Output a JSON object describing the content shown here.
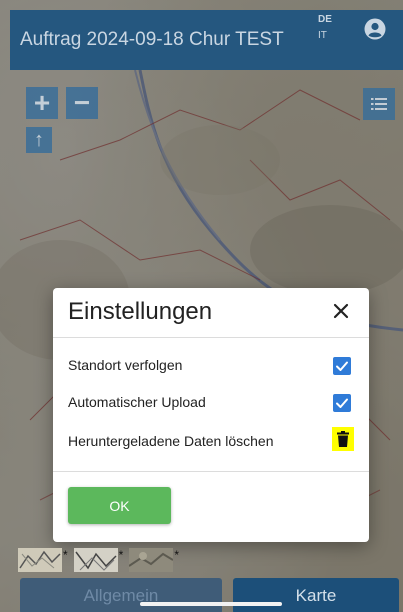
{
  "header": {
    "title": "Auftrag 2024-09-18 Chur TEST",
    "languages": [
      "DE",
      "IT"
    ],
    "user_icon": "user-circle-icon"
  },
  "map_controls": {
    "zoom_in": "+",
    "zoom_out": "−",
    "north": "↑",
    "layers_icon": "list-icon"
  },
  "dialog": {
    "title": "Einstellungen",
    "close_icon": "close-icon",
    "settings": [
      {
        "label": "Standort verfolgen",
        "checked": true
      },
      {
        "label": "Automatischer Upload",
        "checked": true
      },
      {
        "label": "Heruntergeladene Daten löschen",
        "icon": "trash-icon"
      }
    ],
    "ok_label": "OK"
  },
  "thumbnails": [
    {
      "name": "map-layer-1",
      "marker": "*"
    },
    {
      "name": "map-layer-2",
      "marker": "*"
    },
    {
      "name": "map-layer-3",
      "marker": "*"
    }
  ],
  "tabs": [
    {
      "label": "Allgemein",
      "active": false
    },
    {
      "label": "Karte",
      "active": true
    }
  ],
  "colors": {
    "header": "#25577f",
    "accent_checkbox": "#2f7bd8",
    "ok_button": "#5cb85c",
    "trash_highlight": "#ffff00"
  }
}
